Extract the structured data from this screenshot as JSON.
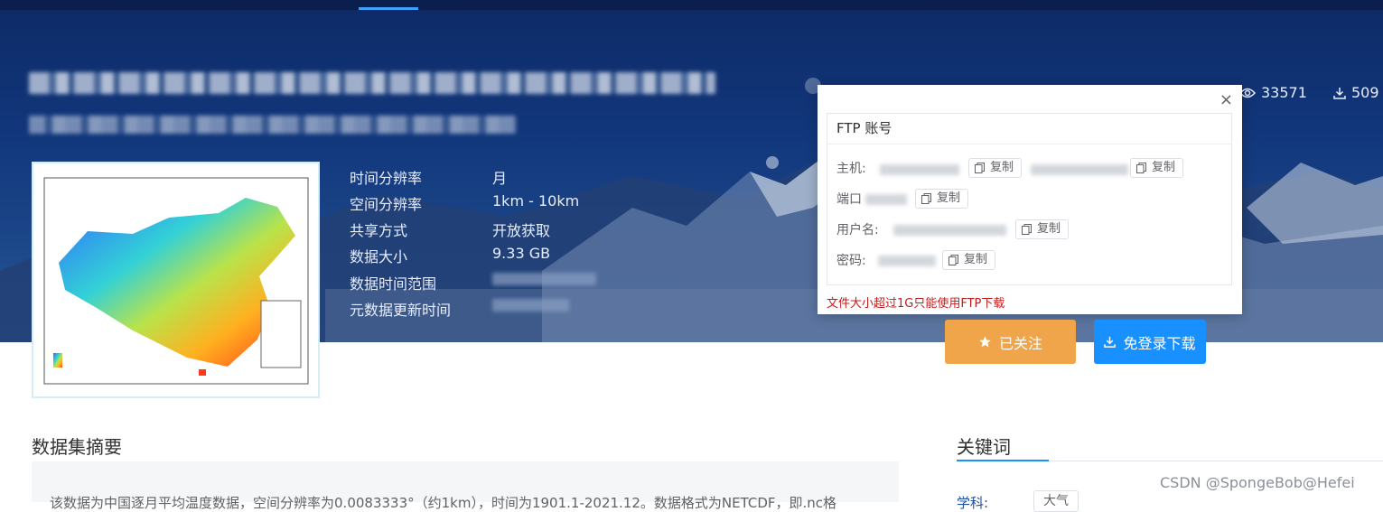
{
  "stats": {
    "views": "33571",
    "downloads": "509"
  },
  "metadata": [
    {
      "label": "时间分辨率",
      "value": "月"
    },
    {
      "label": "空间分辨率",
      "value": "1km - 10km"
    },
    {
      "label": "共享方式",
      "value": "开放获取"
    },
    {
      "label": "数据大小",
      "value": "9.33 GB"
    },
    {
      "label": "数据时间范围",
      "value": ""
    },
    {
      "label": "元数据更新时间",
      "value": ""
    }
  ],
  "ftp": {
    "title": "FTP 账号",
    "host_label": "主机:",
    "port_label": "端口",
    "user_label": "用户名:",
    "password_label": "密码:",
    "copy_label": "复制",
    "note": "文件大小超过1G只能使用FTP下载",
    "close_glyph": "×"
  },
  "buttons": {
    "follow": "已关注",
    "download": "免登录下载"
  },
  "sections": {
    "abstract_title": "数据集摘要",
    "keywords_title": "关键词"
  },
  "keywords": {
    "subject_label": "学科:",
    "tag": "大气"
  },
  "abstract": {
    "text": "该数据为中国逐月平均温度数据，空间分辨率为0.0083333°（约1km），时间为1901.1-2021.12。数据格式为NETCDF，即.nc格"
  },
  "watermark": "CSDN @SpongeBob@Hefei",
  "icons": {
    "eye": "eye-icon",
    "download": "download-icon",
    "star": "star-icon",
    "copy": "copy-icon",
    "close": "close-icon"
  },
  "colors": {
    "accent": "#1890ff",
    "follow": "#f0a54b",
    "note": "#c41c1c"
  }
}
